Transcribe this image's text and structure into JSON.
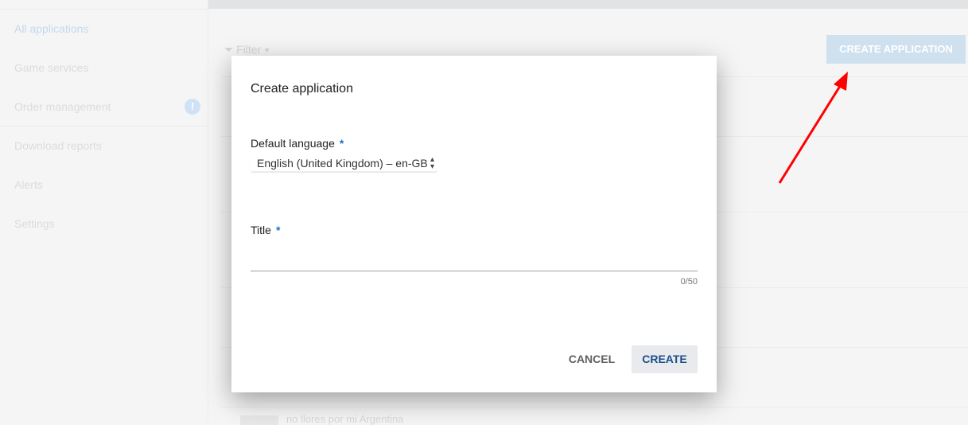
{
  "sidebar": {
    "items": [
      {
        "label": "All applications",
        "active": true
      },
      {
        "label": "Game services"
      },
      {
        "label": "Order management",
        "badge": "!"
      },
      {
        "label": "Download reports"
      },
      {
        "label": "Alerts"
      },
      {
        "label": "Settings"
      }
    ]
  },
  "main": {
    "filter_label": "Filter",
    "create_application": "CREATE APPLICATION",
    "bg_row_text": "no llores por mi Argentina"
  },
  "dialog": {
    "title": "Create application",
    "language_label": "Default language",
    "language_value": "English (United Kingdom) – en-GB",
    "title_label": "Title",
    "required_mark": "*",
    "title_value": "",
    "counter": "0/50",
    "cancel": "CANCEL",
    "create": "CREATE"
  },
  "colors": {
    "accent": "#1a73c8",
    "annotation_arrow": "#ff0000"
  }
}
